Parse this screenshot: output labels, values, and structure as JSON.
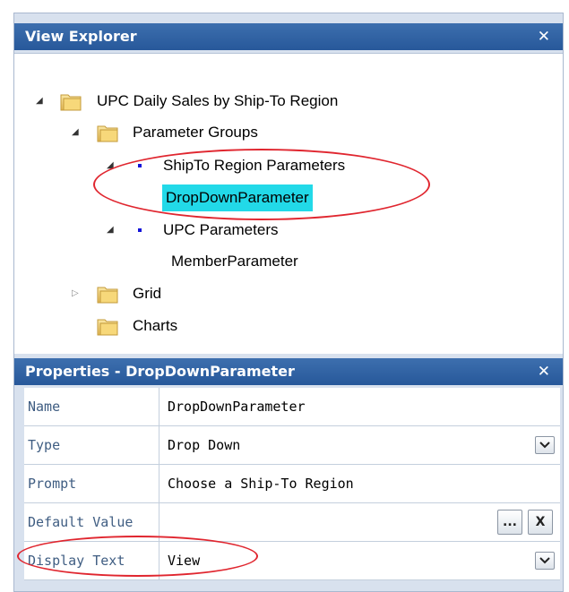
{
  "view_explorer": {
    "title": "View Explorer",
    "close_glyph": "✕",
    "tree": [
      {
        "label": "UPC Daily Sales by Ship-To Region",
        "icon": "folder-icon",
        "expander": "◢"
      },
      {
        "label": "Parameter Groups",
        "icon": "folder-icon",
        "expander": "◢"
      },
      {
        "label": "ShipTo Region Parameters",
        "icon": "parameter-bullet-icon",
        "expander": "◢"
      },
      {
        "label": "DropDownParameter",
        "selected": true
      },
      {
        "label": "UPC Parameters",
        "icon": "parameter-bullet-icon",
        "expander": "◢"
      },
      {
        "label": "MemberParameter"
      },
      {
        "label": "Grid",
        "icon": "folder-icon",
        "expander": "▷"
      },
      {
        "label": "Charts",
        "icon": "folder-icon"
      }
    ]
  },
  "properties": {
    "title": "Properties - DropDownParameter",
    "close_glyph": "✕",
    "rows": [
      {
        "name": "Name",
        "value": "DropDownParameter"
      },
      {
        "name": "Type",
        "value": "Drop Down"
      },
      {
        "name": "Prompt",
        "value": "Choose a Ship-To Region"
      },
      {
        "name": "Default Value",
        "value": "",
        "ellipsis_label": "...",
        "clear_label": "X"
      },
      {
        "name": "Display Text",
        "value": "View"
      }
    ]
  },
  "colors": {
    "header": "#2f5f9f",
    "selection": "#22d9e8",
    "callout": "#e0262f",
    "bullet": "#1414d9"
  }
}
